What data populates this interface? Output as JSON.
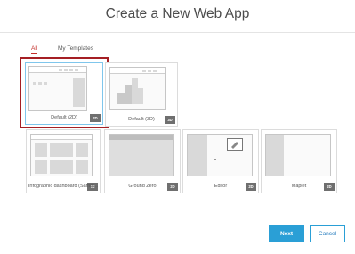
{
  "dialog": {
    "title": "Create a New Web App"
  },
  "tabs": [
    {
      "label": "All",
      "active": true
    },
    {
      "label": "My Templates",
      "active": false
    }
  ],
  "templates": [
    {
      "label": "Default (2D)",
      "badge": "2D",
      "selected": true
    },
    {
      "label": "Default (3D)",
      "badge": "3D",
      "selected": false
    },
    {
      "label": "Infographic dashboard (Sampl...",
      "badge": "2D",
      "selected": false
    },
    {
      "label": "Ground Zero",
      "badge": "2D",
      "selected": false
    },
    {
      "label": "Editor",
      "badge": "2D",
      "selected": false
    },
    {
      "label": "Maplet",
      "badge": "2D",
      "selected": false
    }
  ],
  "buttons": {
    "next": "Next",
    "cancel": "Cancel"
  },
  "colors": {
    "primary": "#2a9fd6",
    "selection": "#a51f24",
    "active_tab": "#c4302b"
  }
}
